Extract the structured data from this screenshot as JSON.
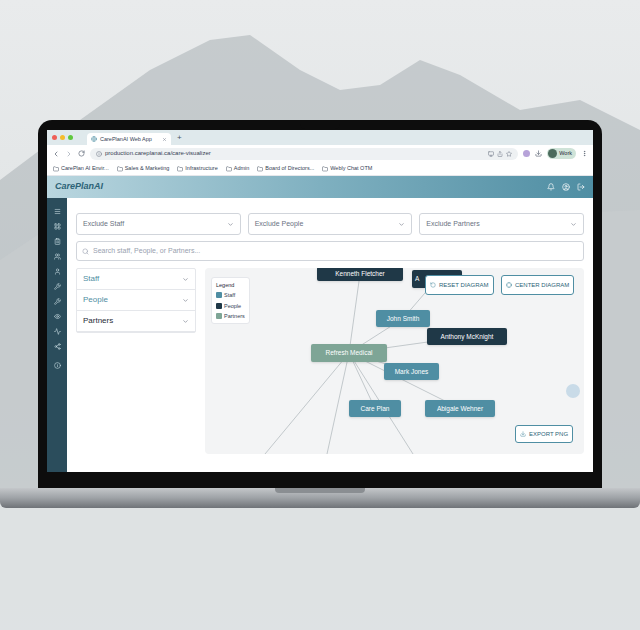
{
  "browser": {
    "tab_title": "CarePlanAI Web App",
    "new_tab": "+",
    "url": "production.careplanai.ca/care-visualizer",
    "profile": "Work",
    "bookmarks": [
      "CarePlan AI Envir...",
      "Sales & Marketing",
      "Infrastructure",
      "Admin",
      "Board of Directors...",
      "Webly Chat OTM"
    ]
  },
  "app": {
    "logo": "CarePlanAI"
  },
  "filters": [
    {
      "placeholder": "Exclude Staff"
    },
    {
      "placeholder": "Exclude People"
    },
    {
      "placeholder": "Exclude Partners"
    }
  ],
  "search": {
    "placeholder": "Search staff, People, or Partners..."
  },
  "categories": [
    {
      "label": "Staff",
      "expanded": false,
      "color": "#4f8ea3"
    },
    {
      "label": "People",
      "expanded": false,
      "color": "#4f8ea3"
    },
    {
      "label": "Partners",
      "expanded": false,
      "color": "#1f2d36"
    }
  ],
  "legend": {
    "title": "Legend",
    "items": [
      {
        "label": "Staff",
        "color": "#4f8ea3"
      },
      {
        "label": "People",
        "color": "#1f3847"
      },
      {
        "label": "Partners",
        "color": "#7ea596"
      }
    ]
  },
  "diagram": {
    "buttons": [
      "RESET DIAGRAM",
      "CENTER DIAGRAM"
    ],
    "export": "EXPORT PNG",
    "nodes": [
      {
        "label": "Kenneth Fletcher",
        "kind": "people"
      },
      {
        "label": "A",
        "kind": "people"
      },
      {
        "label": "John Smith",
        "kind": "staff"
      },
      {
        "label": "Anthony McKnight",
        "kind": "people"
      },
      {
        "label": "Refresh Medical",
        "kind": "partner"
      },
      {
        "label": "Mark Jones",
        "kind": "staff"
      },
      {
        "label": "Care Plan",
        "kind": "staff"
      },
      {
        "label": "Abigale Wehner",
        "kind": "staff"
      }
    ],
    "edges": [
      [
        "Refresh Medical",
        "Kenneth Fletcher"
      ],
      [
        "Refresh Medical",
        "John Smith"
      ],
      [
        "Refresh Medical",
        "Anthony McKnight"
      ],
      [
        "Refresh Medical",
        "Mark Jones"
      ],
      [
        "Refresh Medical",
        "Care Plan"
      ],
      [
        "Refresh Medical",
        "Abigale Wehner"
      ],
      [
        "John Smith",
        "A"
      ]
    ]
  }
}
